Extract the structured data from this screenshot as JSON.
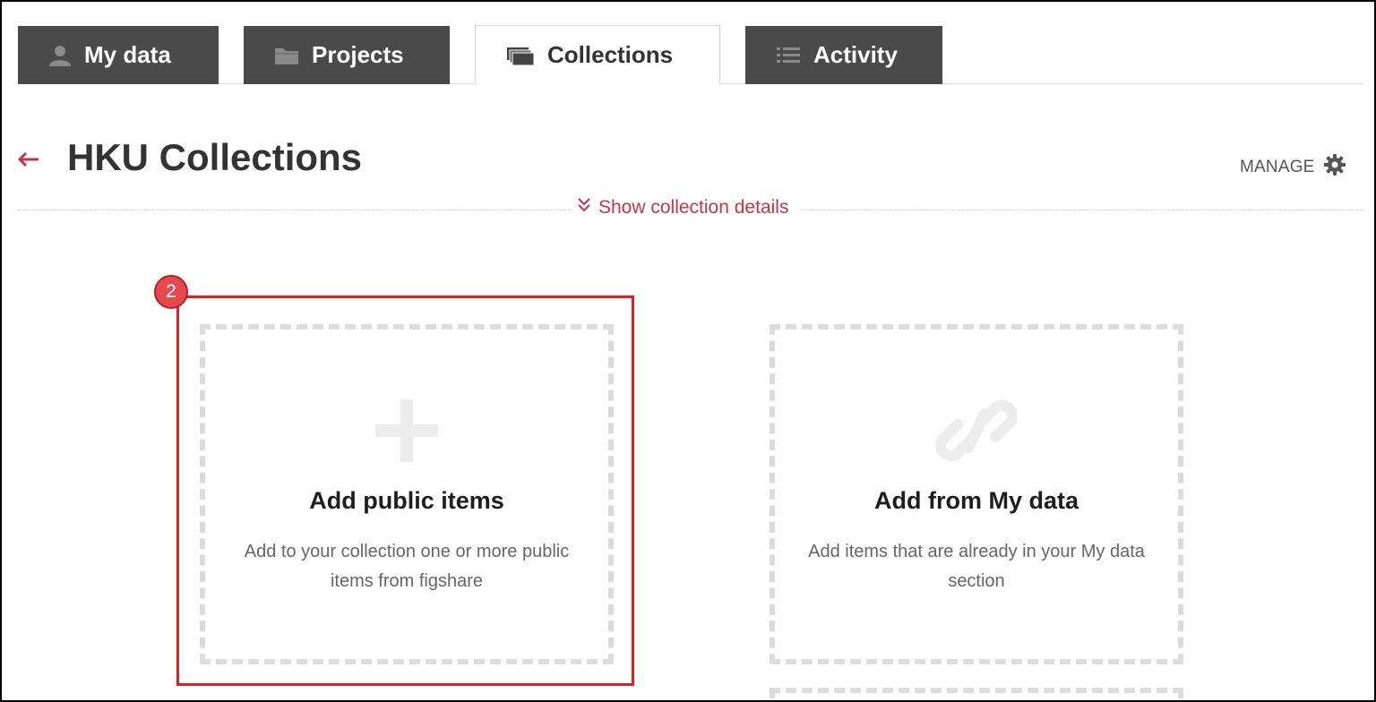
{
  "tabs": [
    {
      "label": "My data",
      "icon": "user-icon",
      "active": false
    },
    {
      "label": "Projects",
      "icon": "folder-icon",
      "active": false
    },
    {
      "label": "Collections",
      "icon": "collections-icon",
      "active": true
    },
    {
      "label": "Activity",
      "icon": "list-icon",
      "active": false
    }
  ],
  "header": {
    "back_icon": "back-arrow-icon",
    "title": "HKU Collections",
    "manage_label": "MANAGE",
    "manage_icon": "gear-icon"
  },
  "details_toggle": {
    "label": "Show collection details",
    "icon": "double-chevron-down-icon"
  },
  "cards": [
    {
      "icon": "plus-icon",
      "title": "Add public items",
      "description": "Add to your collection one or more public items from figshare"
    },
    {
      "icon": "link-icon",
      "title": "Add from My data",
      "description": "Add items that are already in your My data section"
    }
  ],
  "annotation": {
    "step_number": "2"
  },
  "colors": {
    "accent": "#c8334a",
    "tab_dark": "#4a4a4a",
    "highlight": "#e02020"
  }
}
